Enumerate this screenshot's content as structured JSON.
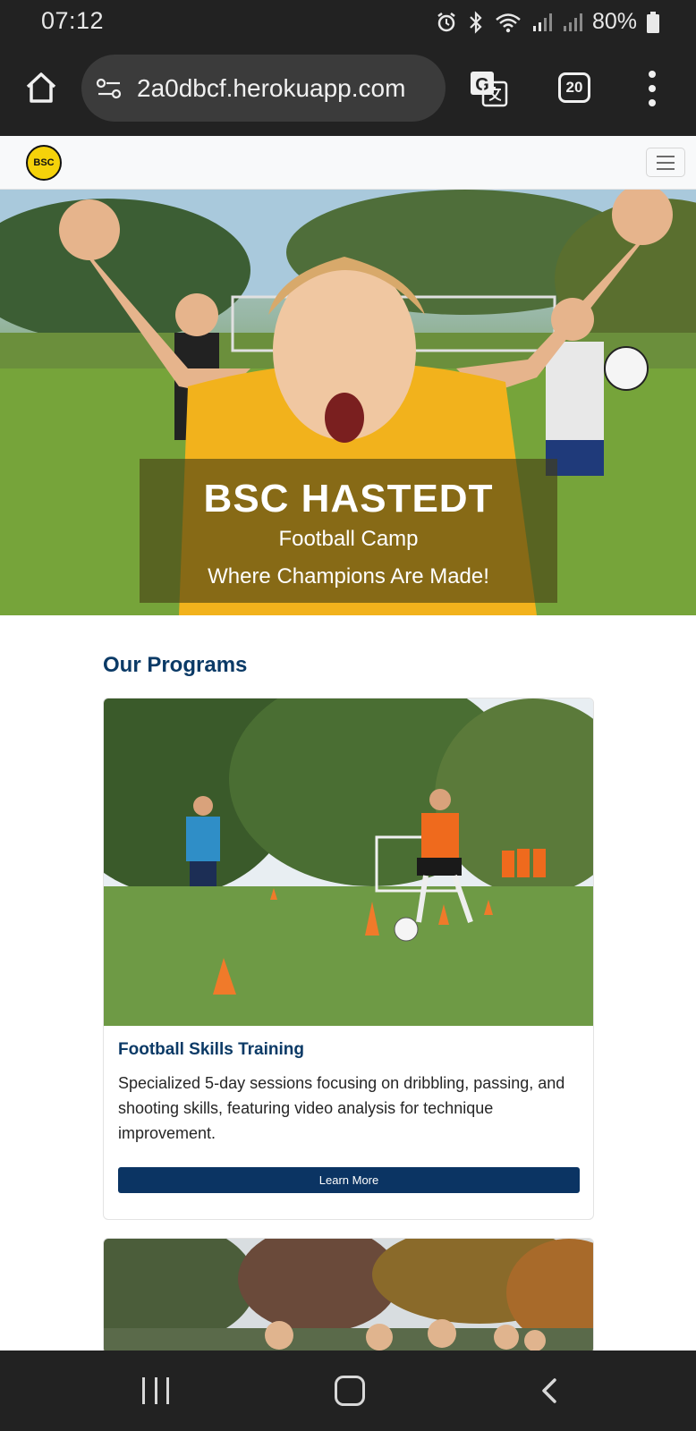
{
  "status_bar": {
    "time": "07:12",
    "icons": [
      "alarm-icon",
      "bluetooth-icon",
      "wifi-icon",
      "signal-icon",
      "signal-icon",
      "battery-icon"
    ],
    "battery_percent": "80%"
  },
  "browser": {
    "url": "2a0dbcf.herokuapp.com",
    "tab_count": "20"
  },
  "site": {
    "logo_text": "BSC"
  },
  "hero": {
    "title": "BSC HASTEDT",
    "subtitle": "Football Camp",
    "tagline": "Where Champions Are Made!"
  },
  "programs": {
    "heading": "Our Programs",
    "items": [
      {
        "title": "Football Skills Training",
        "description": "Specialized 5-day sessions focusing on dribbling, passing, and shooting skills, featuring video analysis for technique improvement.",
        "button_label": "Learn More"
      }
    ]
  },
  "colors": {
    "brand_navy": "#0b3463",
    "heading_blue": "#0b3a66",
    "logo_yellow": "#f5d20a",
    "chrome_dark": "#222222"
  }
}
